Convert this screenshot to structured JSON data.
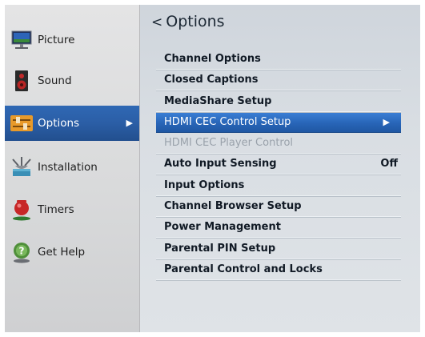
{
  "sidebar": {
    "items": [
      {
        "label": "Picture",
        "icon": "monitor-icon"
      },
      {
        "label": "Sound",
        "icon": "speaker-icon"
      },
      {
        "label": "Options",
        "icon": "sliders-icon",
        "arrow": "▶"
      },
      {
        "label": "Installation",
        "icon": "satellite-dish-icon"
      },
      {
        "label": "Timers",
        "icon": "alarm-timer-icon"
      },
      {
        "label": "Get Help",
        "icon": "help-icon"
      }
    ]
  },
  "header": {
    "back": "<",
    "title": "Options"
  },
  "menu": {
    "items": [
      {
        "label": "Channel Options"
      },
      {
        "label": "Closed Captions"
      },
      {
        "label": "MediaShare Setup"
      },
      {
        "label": "HDMI CEC Control Setup",
        "arrow": "▶"
      },
      {
        "label": "HDMI CEC Player Control"
      },
      {
        "label": "Auto Input Sensing",
        "value": "Off"
      },
      {
        "label": "Input Options"
      },
      {
        "label": "Channel Browser Setup"
      },
      {
        "label": "Power Management"
      },
      {
        "label": "Parental PIN Setup"
      },
      {
        "label": "Parental Control and Locks"
      }
    ]
  },
  "colors": {
    "selection": "#2b5ea6",
    "sidebar_bg": "#dcdcdd",
    "panel_bg": "#d9dee3",
    "disabled_text": "#9aa2ab"
  }
}
